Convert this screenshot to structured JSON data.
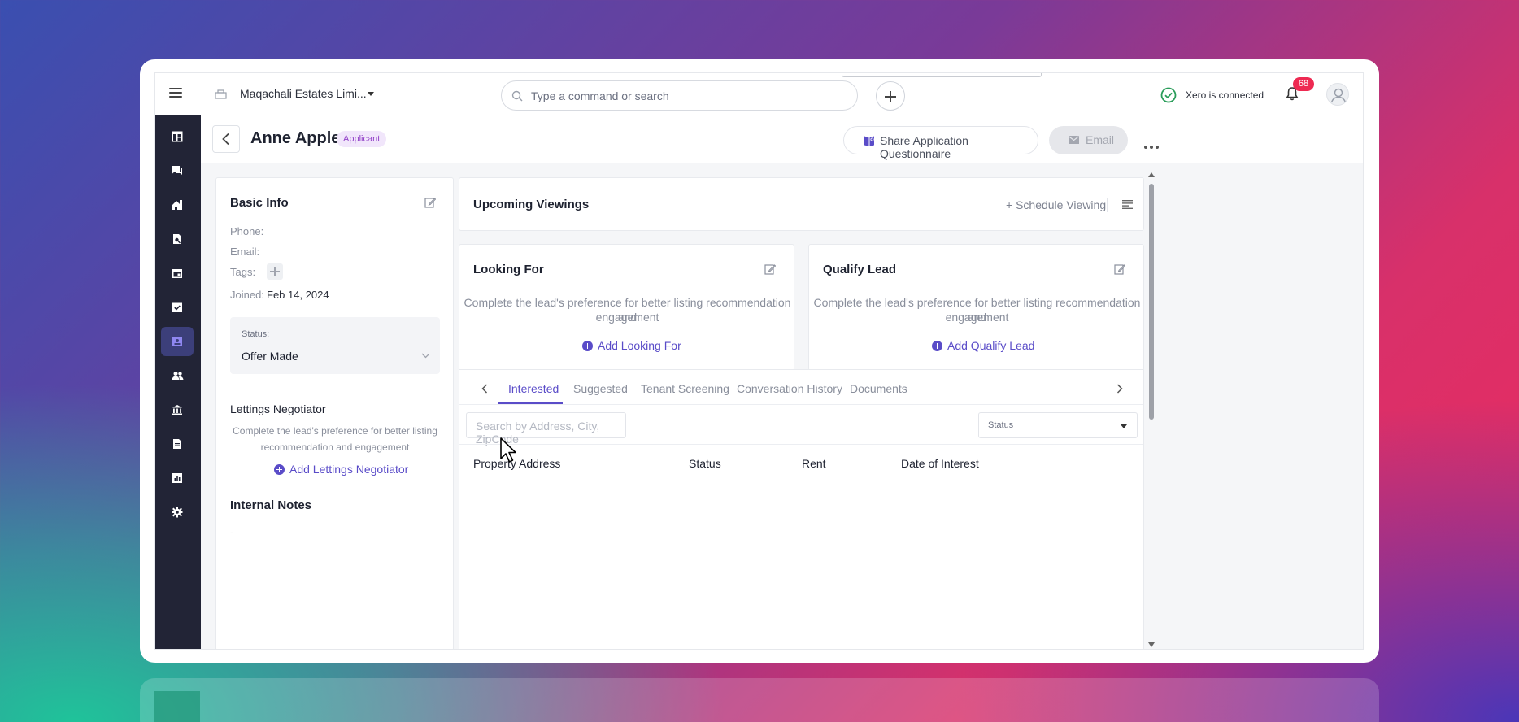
{
  "topbar": {
    "company_name": "Maqachali Estates Limi...",
    "search_placeholder": "Type a command or search",
    "xero_status": "Xero is connected",
    "notification_count": "68"
  },
  "sidebar": {
    "items": [
      {
        "icon": "dashboard-icon",
        "active": false
      },
      {
        "icon": "chat-icon",
        "active": false
      },
      {
        "icon": "home-icon",
        "active": false
      },
      {
        "icon": "search-property-icon",
        "active": false
      },
      {
        "icon": "calendar-icon",
        "active": false
      },
      {
        "icon": "task-check-icon",
        "active": false
      },
      {
        "icon": "contact-card-icon",
        "active": true
      },
      {
        "icon": "people-icon",
        "active": false
      },
      {
        "icon": "bank-icon",
        "active": false
      },
      {
        "icon": "document-icon",
        "active": false
      },
      {
        "icon": "report-chart-icon",
        "active": false
      },
      {
        "icon": "settings-icon",
        "active": false
      }
    ]
  },
  "header": {
    "title": "Anne Apple",
    "tag": "Applicant",
    "share_label": "Share Application Questionnaire",
    "email_label": "Email"
  },
  "basic_info": {
    "title": "Basic Info",
    "phone_label": "Phone:",
    "email_label": "Email:",
    "tags_label": "Tags:",
    "joined_label": "Joined:",
    "joined_value": "Feb 14, 2024",
    "status_label": "Status:",
    "status_value": "Offer Made",
    "negotiator_title": "Lettings Negotiator",
    "negotiator_hint_line1": "Complete the lead's preference for better listing",
    "negotiator_hint_line2": "recommendation and engagement",
    "add_negotiator": "Add Lettings Negotiator",
    "notes_title": "Internal Notes",
    "notes_value": "-"
  },
  "viewings": {
    "title": "Upcoming Viewings",
    "schedule_label": "+ Schedule Viewing"
  },
  "looking_for": {
    "title": "Looking For",
    "hint_line1": "Complete the lead's preference for better listing recommendation and",
    "hint_line2": "engagement",
    "add_label": "Add Looking For"
  },
  "qualify_lead": {
    "title": "Qualify Lead",
    "hint_line1": "Complete the lead's preference for better listing recommendation and",
    "hint_line2": "engagement",
    "add_label": "Add Qualify Lead"
  },
  "tabs": {
    "items": [
      "Interested",
      "Suggested",
      "Tenant Screening",
      "Conversation History",
      "Documents"
    ],
    "active": "Interested",
    "address_search_placeholder": "Search by Address, City, ZipCode",
    "status_filter": "Status",
    "columns": [
      "Property Address",
      "Status",
      "Rent",
      "Date of Interest"
    ]
  },
  "colors": {
    "accent": "#5a4cc8",
    "sidebar": "#222436",
    "badge": "#ee2a52",
    "tag_bg": "#f1e6fb",
    "xero_green": "#2a9d5a"
  }
}
